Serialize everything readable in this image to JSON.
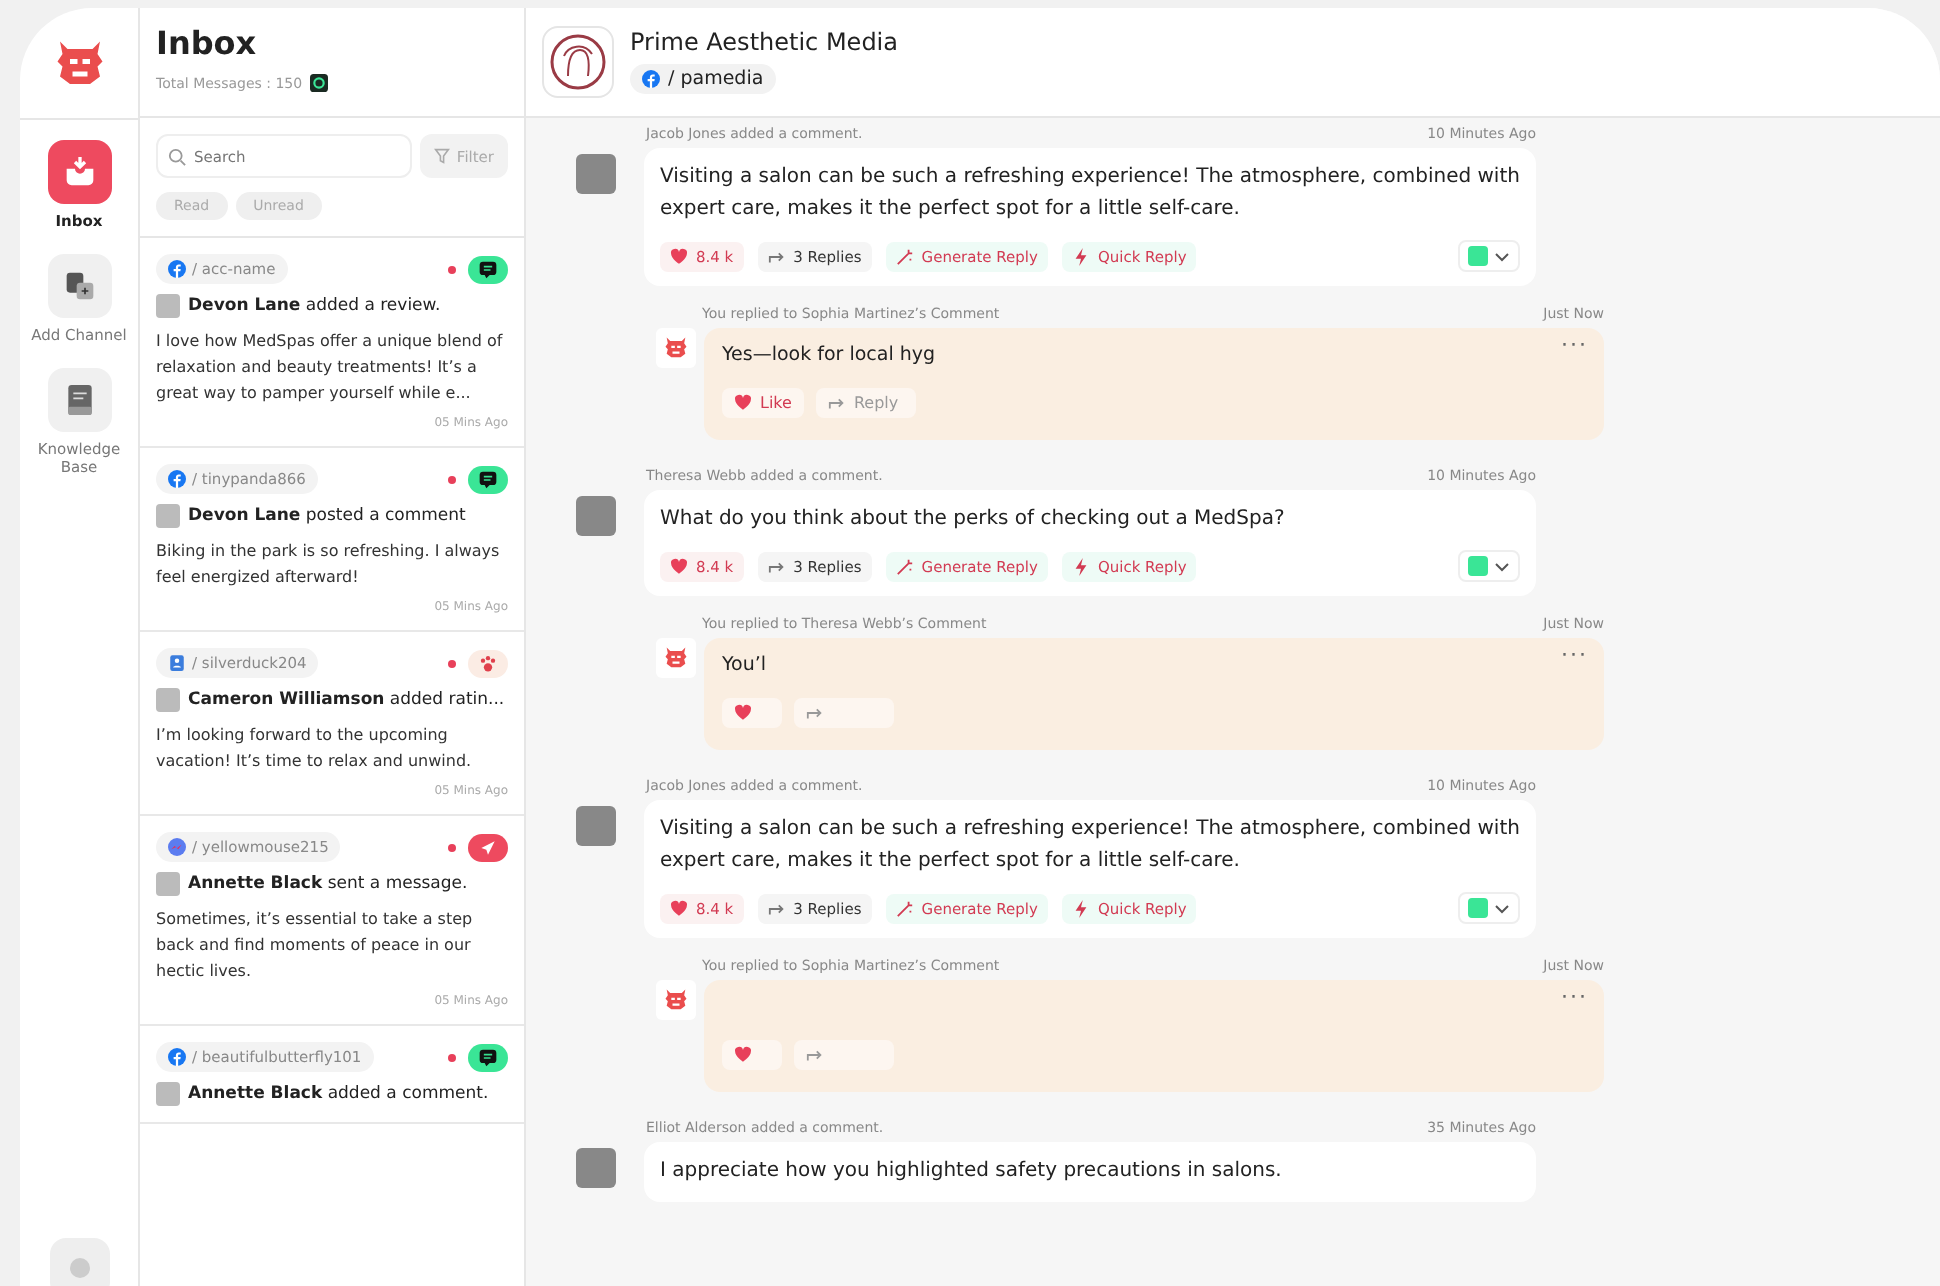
{
  "nav": {
    "items": [
      {
        "label": "Inbox",
        "kind": "inbox",
        "selected": true
      },
      {
        "label": "Add Channel",
        "kind": "add",
        "selected": false
      },
      {
        "label": "Knowledge Base",
        "kind": "book",
        "selected": false
      }
    ]
  },
  "inbox": {
    "title": "Inbox",
    "total_label": "Total Messages : 150",
    "search": {
      "placeholder": "Search"
    },
    "filter": "Filter",
    "chips": [
      "Read",
      "Unread"
    ],
    "items": [
      {
        "handle": {
          "kind": "facebook",
          "text": "/ acc-name"
        },
        "unread": true,
        "badge": {
          "kind": "comment"
        },
        "author": "Devon Lane",
        "action": "added a review.",
        "message": "I love how MedSpas offer a unique blend of relaxation and beauty treatments! It’s a great way to pamper yourself while e...",
        "time": "05 Mins Ago"
      },
      {
        "handle": {
          "kind": "facebook",
          "text": "/ tinypanda866"
        },
        "unread": true,
        "badge": {
          "kind": "comment"
        },
        "author": "Devon Lane",
        "action": "posted a comment",
        "message": "Biking in the park is so refreshing. I always feel energized afterward!",
        "time": "05 Mins Ago"
      },
      {
        "handle": {
          "kind": "contacts",
          "text": "/ silverduck204"
        },
        "unread": true,
        "badge": {
          "kind": "rating"
        },
        "author": "Cameron Williamson",
        "action": "added ratin...",
        "message": "I’m looking forward to the upcoming vacation! It’s time to relax and unwind.",
        "time": "05 Mins Ago"
      },
      {
        "handle": {
          "kind": "messenger",
          "text": "/ yellowmouse215"
        },
        "unread": true,
        "badge": {
          "kind": "message"
        },
        "author": "Annette Black",
        "action": "sent a message.",
        "message": "Sometimes, it’s essential to take a step back and find moments of peace in our hectic lives.",
        "time": "05 Mins Ago"
      },
      {
        "handle": {
          "kind": "facebook",
          "text": "/ beautifulbutterfly101"
        },
        "unread": true,
        "badge": {
          "kind": "comment"
        },
        "author": "Annette Black",
        "action": "added a comment."
      }
    ]
  },
  "page": {
    "name": "Prime Aesthetic Media",
    "handle": "/ pamedia"
  },
  "thread": [
    {
      "header": "Jacob Jones added a comment.",
      "time": "10 Minutes Ago",
      "text": "Visiting a salon can be such a refreshing experience! The atmosphere, combined with expert care, makes it the perfect spot for a little self-care.",
      "likes": "8.4 k",
      "replies": "3 Replies",
      "generate": "Generate Reply",
      "quick": "Quick Reply",
      "reply": {
        "header": "You replied to Sophia Martinez’s Comment",
        "time": "Just Now",
        "text": "Yes—look for local hyg",
        "more": "···",
        "like": "Like",
        "reply": "Reply"
      }
    },
    {
      "header": "Theresa Webb added a comment.",
      "time": "10 Minutes Ago",
      "text": "What do you think about the perks of checking out a MedSpa?",
      "likes": "8.4 k",
      "replies": "3 Replies",
      "generate": "Generate Reply",
      "quick": "Quick Reply",
      "reply": {
        "header": "You replied to Theresa Webb’s Comment",
        "time": "Just Now",
        "text": "You’l",
        "more": "···"
      }
    },
    {
      "header": "Jacob Jones added a comment.",
      "time": "10 Minutes Ago",
      "text": "Visiting a salon can be such a refreshing experience! The atmosphere, combined with expert care, makes it the perfect spot for a little self-care.",
      "likes": "8.4 k",
      "replies": "3 Replies",
      "generate": "Generate Reply",
      "quick": "Quick Reply",
      "reply": {
        "header": "You replied to Sophia Martinez’s Comment",
        "time": "Just Now",
        "more": "···"
      }
    },
    {
      "header": "Elliot Alderson added a comment.",
      "time": "35 Minutes Ago",
      "text": "I appreciate how you highlighted safety precautions in salons."
    }
  ]
}
